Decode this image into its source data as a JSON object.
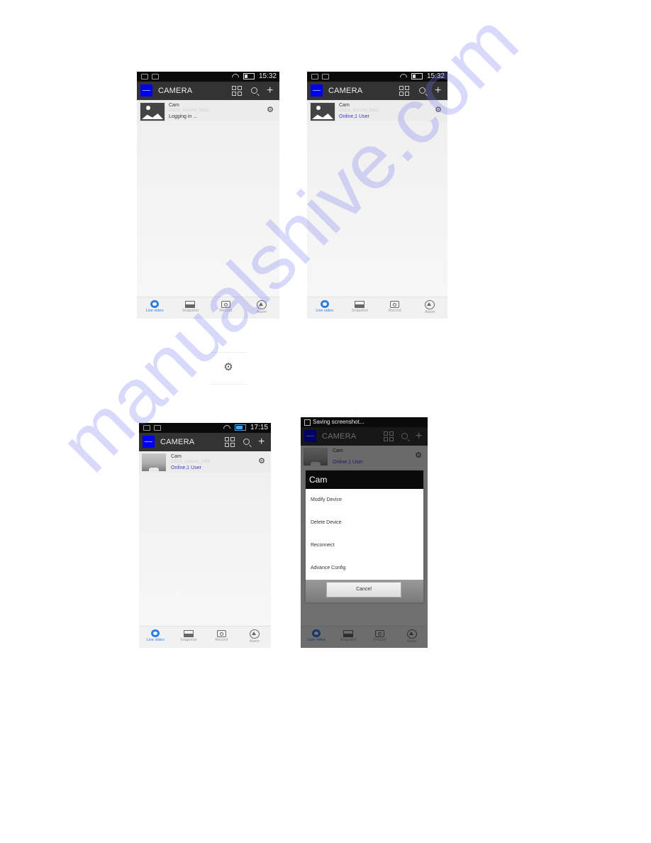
{
  "screens": [
    {
      "id": "logging-in",
      "status_bar": {
        "time": "15:32",
        "battery_color": "#dddddd"
      },
      "app_bar": {
        "title": "CAMERA",
        "logo_color": "#0000ee"
      },
      "device": {
        "name": "Cam",
        "id": "ZSCS_AAAAA_5491",
        "status": "Logging in ...",
        "status_color": "#333333"
      },
      "tabs": [
        {
          "label": "Live video",
          "icon": "live-video-icon",
          "active": true
        },
        {
          "label": "Snapshot",
          "icon": "snapshot-icon",
          "active": false
        },
        {
          "label": "Record",
          "icon": "record-icon",
          "active": false
        },
        {
          "label": "Alarm",
          "icon": "alarm-icon",
          "active": false
        }
      ]
    },
    {
      "id": "online",
      "status_bar": {
        "time": "15:32"
      },
      "app_bar": {
        "title": "CAMERA"
      },
      "device": {
        "name": "Cam",
        "id": "ZSCS_AAAAA_5491",
        "status": "Online,1 User",
        "status_color": "#3a3acf"
      },
      "tabs": [
        {
          "label": "Live video"
        },
        {
          "label": "Snapshot"
        },
        {
          "label": "Record"
        },
        {
          "label": "Alarm"
        }
      ]
    },
    {
      "id": "online-with-preview",
      "status_bar": {
        "time": "17:15",
        "battery_color": "#4aa3e8"
      },
      "app_bar": {
        "title": "CAMERA"
      },
      "device": {
        "name": "Cam",
        "id": "ZSCS_AAAAA_5491",
        "status": "Online,1 User"
      },
      "tabs": [
        {
          "label": "Live video"
        },
        {
          "label": "Snapshot"
        },
        {
          "label": "Record"
        },
        {
          "label": "Alarm"
        }
      ]
    },
    {
      "id": "context-menu",
      "notification": "Saving screenshot...",
      "app_bar": {
        "title": "CAMERA"
      },
      "device": {
        "name": "Cam",
        "status": "Online,1 User"
      },
      "dialog": {
        "title": "Cam",
        "items": [
          "Modify Device",
          "Delete Device",
          "Reconnect",
          "Advance Config"
        ],
        "cancel_label": "Cancel"
      },
      "tabs": [
        {
          "label": "Live video"
        },
        {
          "label": "Snapshot"
        },
        {
          "label": "Record"
        },
        {
          "label": "Alarm"
        }
      ]
    }
  ],
  "settings_gear_callout": {
    "icon": "gear-icon",
    "glyph": "⚙"
  },
  "glyphs": {
    "gear": "⚙",
    "plus": "+"
  },
  "watermark": "manualshive.com",
  "colors": {
    "accent": "#2a7de1",
    "online": "#3a3acf",
    "appbar": "#333333",
    "statusbar": "#0a0a0a"
  }
}
